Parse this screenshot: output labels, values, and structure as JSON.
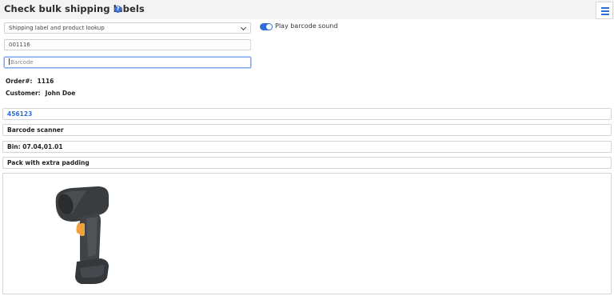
{
  "header": {
    "title": "Check bulk shipping labels",
    "help_icon": "question-circle-icon",
    "menu_icon": "hamburger-menu-icon"
  },
  "form": {
    "lookup_select": {
      "value": "Shipping label and product lookup"
    },
    "order_input": {
      "value": "001116"
    },
    "barcode_input": {
      "placeholder": "Barcode",
      "value": ""
    },
    "barcode_sound": {
      "label": "Play barcode sound",
      "checked": true
    }
  },
  "order": {
    "order_label": "Order#:",
    "order_value": "1116",
    "customer_label": "Customer:",
    "customer_value": "John Doe"
  },
  "item": {
    "sku": "456123",
    "name": "Barcode scanner",
    "bin": "Bin: 07.04,01.01",
    "note": "Pack with extra padding",
    "image_icon": "barcode-scanner-image"
  },
  "colors": {
    "accent": "#2f6fd6",
    "header_bg": "#f3f3f3",
    "border": "#d4d4d4"
  }
}
